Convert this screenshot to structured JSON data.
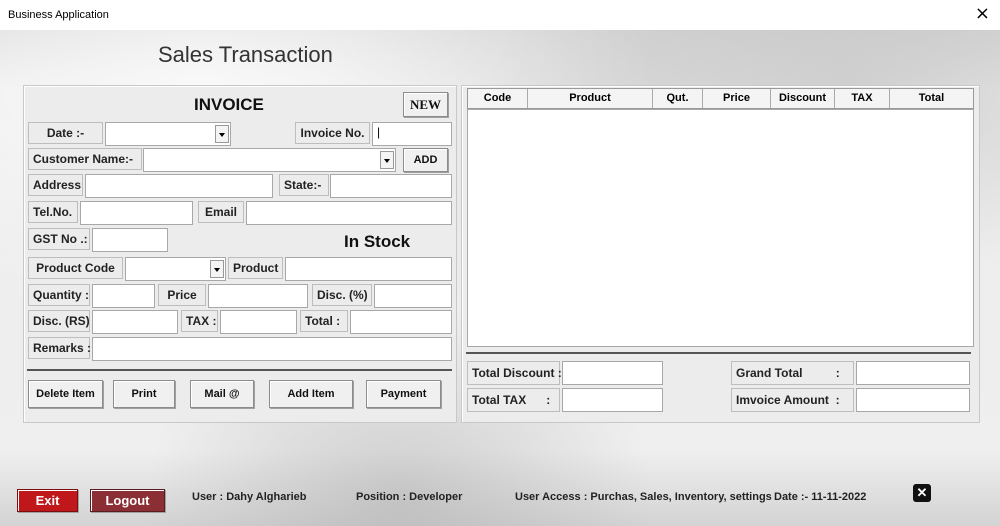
{
  "window": {
    "title": "Business Application",
    "close_icon": "×"
  },
  "heading": "Sales Transaction",
  "invoice": {
    "title": "INVOICE",
    "new_button": "NEW",
    "date_label": "Date  :-",
    "date_value": "",
    "invoice_no_label": "Invoice No.",
    "invoice_no_value": "|",
    "customer_label": "Customer Name:-",
    "customer_value": "",
    "add_button": "ADD",
    "address_label": "Address",
    "address_value": "",
    "state_label": "State:-",
    "state_value": "",
    "tel_label": "Tel.No.",
    "tel_value": "",
    "email_label": "Email",
    "email_value": "",
    "gst_label": "GST No .:",
    "gst_value": "",
    "in_stock": "In Stock",
    "product_code_label": "Product Code",
    "product_code_value": "",
    "product_label": "Product",
    "product_value": "",
    "quantity_label": "Quantity :",
    "quantity_value": "",
    "price_label": "Price",
    "price_value": "",
    "disc_pct_label": "Disc.  (%)",
    "disc_pct_value": "",
    "disc_rs_label": "Disc.  (RS)",
    "disc_rs_value": "",
    "tax_label": "TAX :",
    "tax_value": "",
    "total_label": "Total :",
    "total_value": "",
    "remarks_label": "Remarks :",
    "remarks_value": ""
  },
  "actions": {
    "delete_item": "Delete Item",
    "print": "Print",
    "mail": "Mail @",
    "add_item": "Add  Item",
    "payment": "Payment"
  },
  "grid": {
    "columns": [
      "Code",
      "Product",
      "Qut.",
      "Price",
      "Discount",
      "TAX",
      "Total"
    ],
    "rows": []
  },
  "summary": {
    "total_discount_label": "Total Discount :",
    "total_discount_value": "",
    "total_tax_label": "Total TAX      :",
    "total_tax_value": "",
    "grand_total_label": "Grand Total          :",
    "grand_total_value": "",
    "invoice_amount_label": "Imvoice Amount  :",
    "invoice_amount_value": ""
  },
  "footer": {
    "exit": "Exit",
    "logout": "Logout",
    "user": "User : Dahy Algharieb",
    "position": "Position : Developer",
    "access": "User Access : Purchas, Sales, Inventory, settings",
    "date": "Date  :-  11-11-2022",
    "close_icon": "✕"
  },
  "colors": {
    "exit": "#c0171b",
    "logout": "#8c2f35",
    "footer_text": "#222222"
  }
}
